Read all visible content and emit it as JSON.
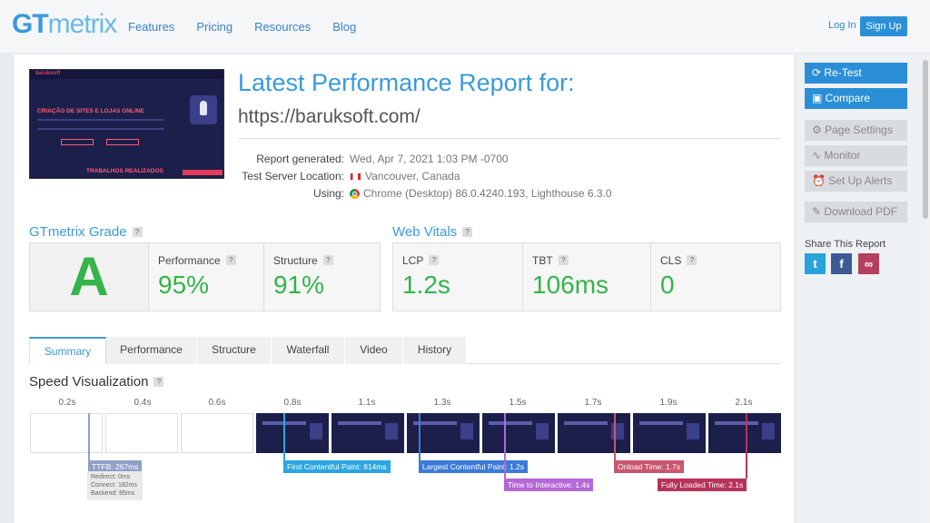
{
  "header": {
    "logo_gt": "GT",
    "logo_metrix": "metrix",
    "nav": [
      "Features",
      "Pricing",
      "Resources",
      "Blog"
    ],
    "login": "Log In",
    "signup": "Sign Up"
  },
  "report": {
    "title": "Latest Performance Report for:",
    "url": "https://baruksoft.com/",
    "generated_label": "Report generated:",
    "generated_value": "Wed, Apr 7, 2021 1:03 PM -0700",
    "location_label": "Test Server Location:",
    "location_value": "Vancouver, Canada",
    "using_label": "Using:",
    "using_value": "Chrome (Desktop) 86.0.4240.193, Lighthouse 6.3.0"
  },
  "thumbnail": {
    "brand": "baruksoft",
    "headline": "CRIAÇÃO DE SITES E LOJAS ONLINE",
    "footer": "TRABALHOS REALIZADOS"
  },
  "grade": {
    "title": "GTmetrix Grade",
    "help": "?",
    "letter": "A",
    "performance_label": "Performance",
    "performance_value": "95%",
    "structure_label": "Structure",
    "structure_value": "91%"
  },
  "vitals": {
    "title": "Web Vitals",
    "help": "?",
    "lcp_label": "LCP",
    "lcp_value": "1.2s",
    "tbt_label": "TBT",
    "tbt_value": "106ms",
    "cls_label": "CLS",
    "cls_value": "0"
  },
  "tabs": [
    "Summary",
    "Performance",
    "Structure",
    "Waterfall",
    "Video",
    "History"
  ],
  "speed": {
    "title": "Speed Visualization",
    "ticks": [
      "0.2s",
      "0.4s",
      "0.6s",
      "0.8s",
      "1.1s",
      "1.3s",
      "1.5s",
      "1.7s",
      "1.9s",
      "2.1s"
    ],
    "ttfb": "TTFB: 267ms",
    "redirect": "Redirect: 0ms",
    "connect": "Connect: 182ms",
    "backend": "Backend: 85ms",
    "fcp": "First Contentful Paint: 814ms",
    "lcp": "Largest Contentful Paint: 1.2s",
    "tti": "Time to Interactive: 1.4s",
    "onload": "Onload Time: 1.7s",
    "fully_loaded": "Fully Loaded Time: 2.1s"
  },
  "sidebar": {
    "retest": "Re-Test",
    "compare": "Compare",
    "page_settings": "Page Settings",
    "monitor": "Monitor",
    "alerts": "Set Up Alerts",
    "pdf": "Download PDF",
    "share_title": "Share This Report"
  },
  "colors": {
    "brand_blue": "#3a9ad9",
    "grade_green": "#34b44a",
    "ttfb": "#8fa0c7",
    "fcp": "#2aa6e0",
    "lcp": "#3b7ad6",
    "tti": "#b467d6",
    "onload": "#c9566e",
    "fully_loaded": "#b8325a"
  },
  "icons": [
    "refresh-icon",
    "compare-icon",
    "gear-icon",
    "pulse-icon",
    "alarm-icon",
    "pdf-icon",
    "twitter-icon",
    "facebook-icon",
    "link-icon",
    "canada-flag-icon",
    "chrome-icon",
    "help-icon"
  ]
}
